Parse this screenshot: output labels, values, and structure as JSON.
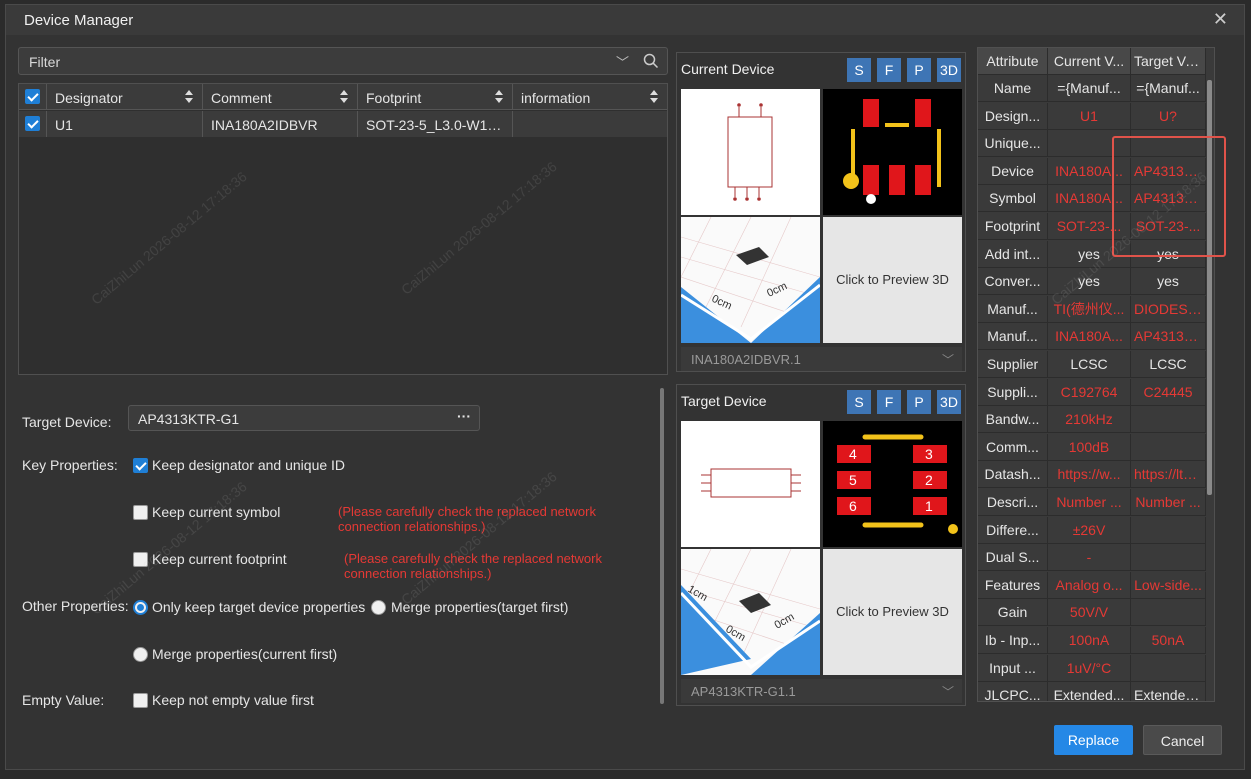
{
  "dialog": {
    "title": "Device Manager"
  },
  "filter": {
    "label": "Filter"
  },
  "table": {
    "columns": [
      "Designator",
      "Comment",
      "Footprint",
      "information"
    ],
    "rows": [
      {
        "designator": "U1",
        "comment": "INA180A2IDBVR",
        "footprint": "SOT-23-5_L3.0-W1.7...",
        "information": ""
      }
    ]
  },
  "form": {
    "target_device_label": "Target Device:",
    "target_device_value": "AP4313KTR-G1",
    "target_device_more": "···",
    "key_properties_label": "Key Properties:",
    "keep_designator": "Keep designator and unique ID",
    "keep_symbol": "Keep current symbol",
    "keep_symbol_note": "(Please carefully check the replaced network connection relationships.)",
    "keep_footprint": "Keep current footprint",
    "keep_footprint_note": "(Please carefully check the replaced network connection relationships.)",
    "other_properties_label": "Other Properties:",
    "only_target": "Only keep target device properties",
    "merge_target_first": "Merge properties(target first)",
    "merge_current_first": "Merge properties(current first)",
    "empty_value_label": "Empty Value:",
    "keep_not_empty": "Keep not empty value first"
  },
  "current_device": {
    "title": "Current Device",
    "buttons": [
      "S",
      "F",
      "P",
      "3D"
    ],
    "preview_3d": "Click to Preview 3D",
    "selected": "INA180A2IDBVR.1"
  },
  "target_device": {
    "title": "Target Device",
    "buttons": [
      "S",
      "F",
      "P",
      "3D"
    ],
    "preview_3d": "Click to Preview 3D",
    "selected": "AP4313KTR-G1.1"
  },
  "attributes": {
    "headers": [
      "Attribute",
      "Current V...",
      "Target Va..."
    ],
    "rows": [
      {
        "name": "Name",
        "current": "={Manuf...",
        "target": "={Manuf...",
        "red": false
      },
      {
        "name": "Design...",
        "current": "U1",
        "target": "U?",
        "red": true
      },
      {
        "name": "Unique...",
        "current": "",
        "target": "",
        "red": false
      },
      {
        "name": "Device",
        "current": "INA180A...",
        "target": "AP4313K...",
        "red": true
      },
      {
        "name": "Symbol",
        "current": "INA180A...",
        "target": "AP4313K...",
        "red": true
      },
      {
        "name": "Footprint",
        "current": "SOT-23-...",
        "target": "SOT-23-...",
        "red": true
      },
      {
        "name": "Add int...",
        "current": "yes",
        "target": "yes",
        "red": false
      },
      {
        "name": "Conver...",
        "current": "yes",
        "target": "yes",
        "red": false
      },
      {
        "name": "Manuf...",
        "current": "TI(德州仪...",
        "target": "DIODES(...",
        "red": true
      },
      {
        "name": "Manuf...",
        "current": "INA180A...",
        "target": "AP4313K...",
        "red": true
      },
      {
        "name": "Supplier",
        "current": "LCSC",
        "target": "LCSC",
        "red": false
      },
      {
        "name": "Suppli...",
        "current": "C192764",
        "target": "C24445",
        "red": true
      },
      {
        "name": "Bandw...",
        "current": "210kHz",
        "target": "",
        "red": true
      },
      {
        "name": "Comm...",
        "current": "100dB",
        "target": "",
        "red": true
      },
      {
        "name": "Datash...",
        "current": "https://w...",
        "target": "https://lte...",
        "red": true
      },
      {
        "name": "Descri...",
        "current": "Number ...",
        "target": "Number ...",
        "red": true
      },
      {
        "name": "Differe...",
        "current": "±26V",
        "target": "",
        "red": true
      },
      {
        "name": "Dual S...",
        "current": "-",
        "target": "",
        "red": true
      },
      {
        "name": "Features",
        "current": "Analog o...",
        "target": "Low-side...",
        "red": true
      },
      {
        "name": "Gain",
        "current": "50V/V",
        "target": "",
        "red": true
      },
      {
        "name": "Ib - Inp...",
        "current": "100nA",
        "target": "50nA",
        "red": true
      },
      {
        "name": "Input ...",
        "current": "1uV/°C",
        "target": "",
        "red": true
      },
      {
        "name": "JLCPC...",
        "current": "Extended...",
        "target": "Extended...",
        "red": false
      }
    ]
  },
  "buttons": {
    "replace": "Replace",
    "cancel": "Cancel"
  },
  "watermark": "CaiZhiLun 2026-08-12 17:18:36",
  "colors": {
    "accent": "#1f7fd6",
    "warning": "#e53935",
    "highlight_box": "#e0534a",
    "view_button": "#3e75b5"
  }
}
